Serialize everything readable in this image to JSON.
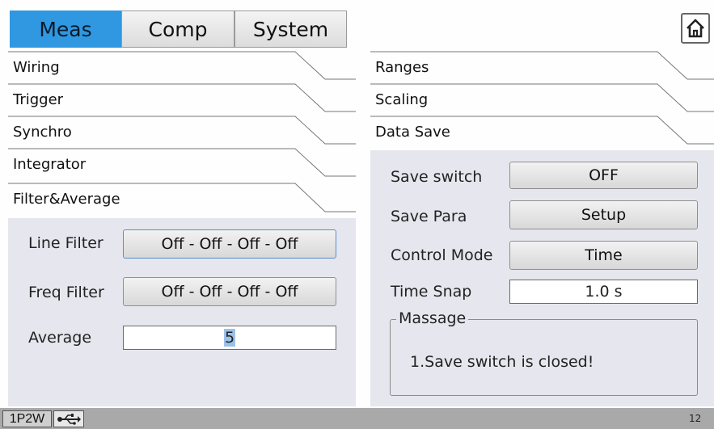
{
  "top_tabs": {
    "meas": "Meas",
    "comp": "Comp",
    "system": "System"
  },
  "left_tabs": {
    "wiring": "Wiring",
    "trigger": "Trigger",
    "synchro": "Synchro",
    "integrator": "Integrator",
    "filter": "Filter&Average"
  },
  "right_tabs": {
    "ranges": "Ranges",
    "scaling": "Scaling",
    "data_save": "Data Save"
  },
  "filter_panel": {
    "line_filter_label": "Line Filter",
    "line_filter_value": "Off - Off - Off - Off",
    "freq_filter_label": "Freq Filter",
    "freq_filter_value": "Off - Off - Off - Off",
    "average_label": "Average",
    "average_value": "5"
  },
  "data_save_panel": {
    "save_switch_label": "Save switch",
    "save_switch_value": "OFF",
    "save_para_label": "Save Para",
    "save_para_value": "Setup",
    "control_mode_label": "Control Mode",
    "control_mode_value": "Time",
    "time_snap_label": "Time Snap",
    "time_snap_value": "1.0 s",
    "message_title": "Massage",
    "message_text": "1.Save switch is closed!"
  },
  "status": {
    "wiring_mode": "1P2W",
    "page_number": "12"
  },
  "icons": {
    "home": "home-icon",
    "usb": "usb-icon"
  },
  "colors": {
    "active_tab": "#2f98e0",
    "panel": "#e6e7ee",
    "statusbar": "#a9a9a9"
  }
}
